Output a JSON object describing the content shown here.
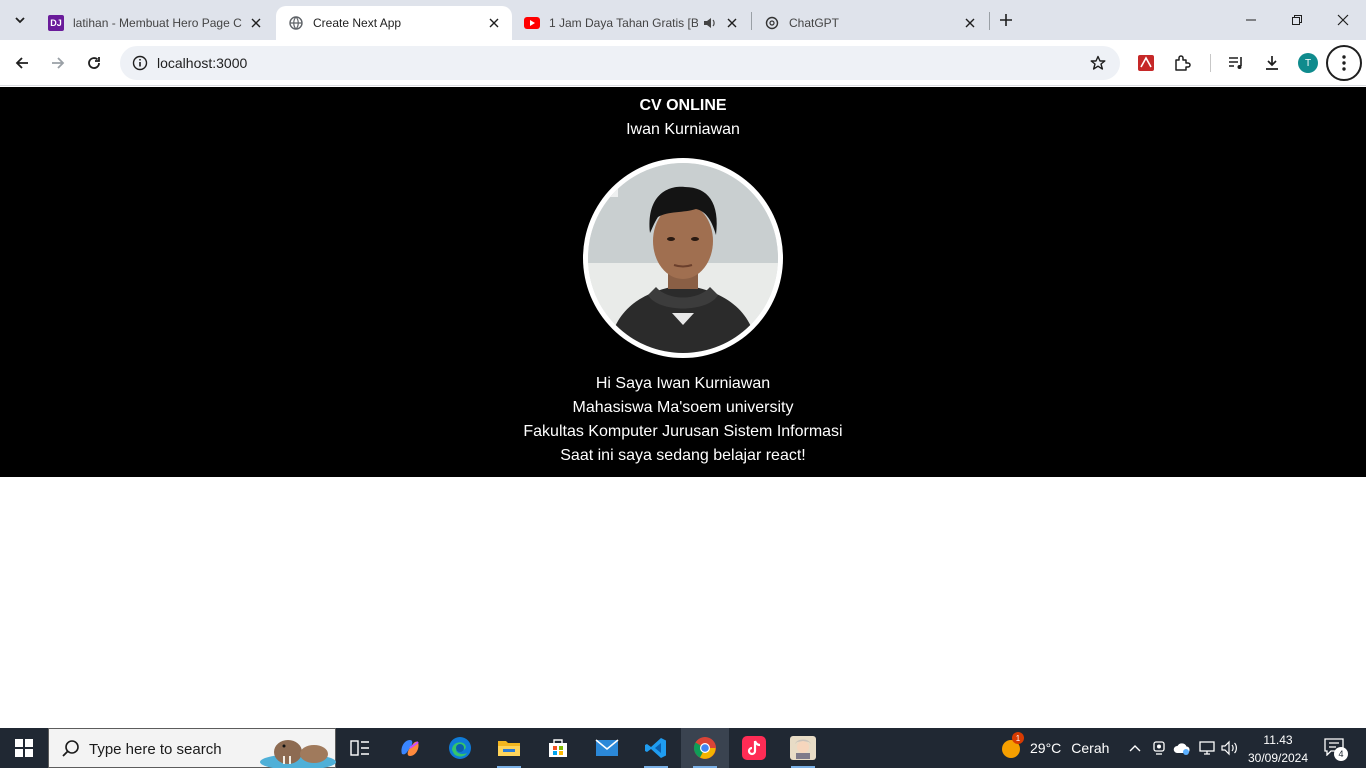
{
  "browser": {
    "tabs": [
      {
        "title": "latihan - Membuat Hero Page C",
        "favicon": "dj-icon",
        "active": false
      },
      {
        "title": "Create Next App",
        "favicon": "globe-icon",
        "active": true
      },
      {
        "title": "1 Jam Daya Tahan Gratis [BC",
        "favicon": "youtube-icon",
        "active": false
      },
      {
        "title": "ChatGPT",
        "favicon": "chatgpt-icon",
        "active": false
      }
    ],
    "favicon_label_dj": "DJ",
    "url": "localhost:3000",
    "profile_initial": "T"
  },
  "page": {
    "title": "CV ONLINE",
    "name": "Iwan Kurniawan",
    "lines": [
      "Hi Saya Iwan Kurniawan",
      "Mahasiswa Ma'soem university",
      "Fakultas Komputer Jurusan Sistem Informasi",
      "Saat ini saya sedang belajar react!"
    ]
  },
  "taskbar": {
    "search_placeholder": "Type here to search",
    "weather_temp": "29°C",
    "weather_text": "Cerah",
    "weather_badge": "1",
    "time": "11.43",
    "date": "30/09/2024",
    "notification_count": "4"
  },
  "colors": {
    "tabstrip": "#dfe3eb",
    "hero_bg": "#000000",
    "taskbar": "#202833"
  }
}
